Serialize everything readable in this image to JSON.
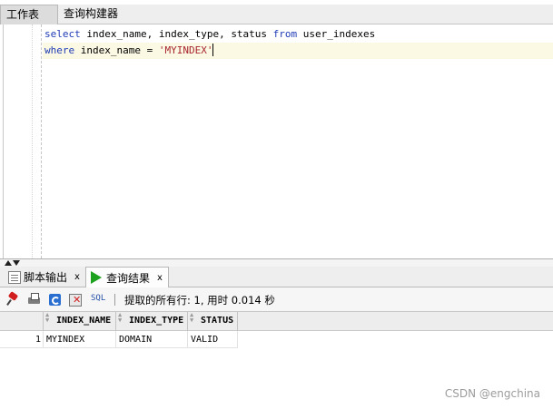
{
  "top_tabs": [
    {
      "label": "工作表"
    },
    {
      "label": "查询构建器"
    }
  ],
  "editor": {
    "line1": {
      "kw_select": "select",
      "mid": " index_name, index_type, status ",
      "kw_from": "from",
      "end": " user_indexes"
    },
    "line2": {
      "kw_where": "where",
      "mid": " index_name = ",
      "string": "'MYINDEX'"
    }
  },
  "bottom_tabs": [
    {
      "label": "脚本输出",
      "close": "x"
    },
    {
      "label": "查询结果",
      "close": "x"
    }
  ],
  "toolbar": {
    "sql_label": "SQL",
    "status": "提取的所有行: 1, 用时 0.014 秒"
  },
  "grid": {
    "columns": [
      "INDEX_NAME",
      "INDEX_TYPE",
      "STATUS"
    ],
    "rows": [
      {
        "num": "1",
        "cells": [
          "MYINDEX",
          "DOMAIN",
          "VALID"
        ]
      }
    ]
  },
  "watermark": "CSDN @engchina"
}
